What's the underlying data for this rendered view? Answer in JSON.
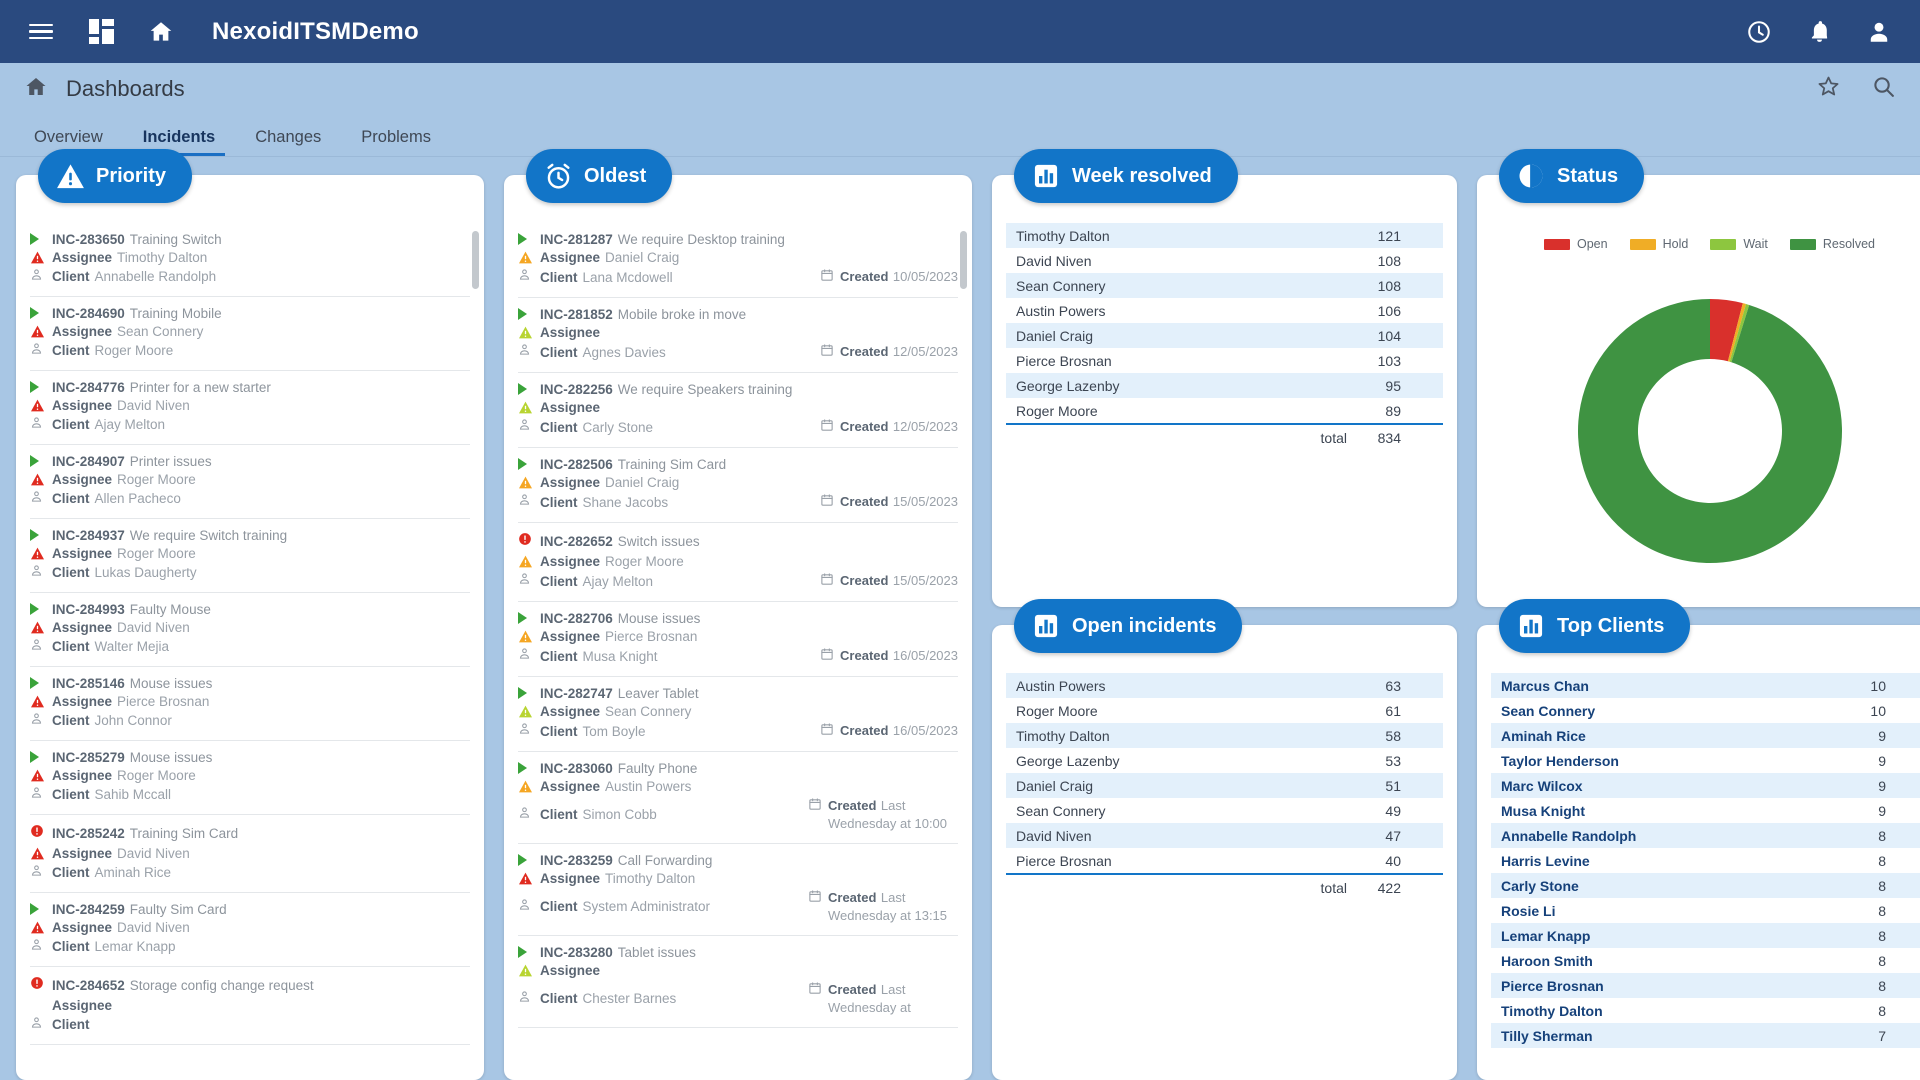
{
  "appbar": {
    "menu_icon": "hamburger-icon",
    "apps_icon": "grid-icon",
    "home_icon": "home-icon",
    "title": "NexoidITSMDemo",
    "history_icon": "clock-icon",
    "notifications_icon": "bell-icon",
    "account_icon": "user-icon"
  },
  "subheader": {
    "home_icon": "home-icon",
    "title": "Dashboards",
    "favorite_icon": "star-icon",
    "search_icon": "search-icon"
  },
  "tabs": [
    {
      "label": "Overview",
      "active": false
    },
    {
      "label": "Incidents",
      "active": true
    },
    {
      "label": "Changes",
      "active": false
    },
    {
      "label": "Problems",
      "active": false
    }
  ],
  "labels": {
    "assignee": "Assignee",
    "client": "Client",
    "created": "Created",
    "total": "total"
  },
  "priority_panel": {
    "title": "Priority",
    "icon": "warning-triangle-icon",
    "items": [
      {
        "id": "INC-283650",
        "subject": "Training Switch",
        "assignee": "Timothy Dalton",
        "client": "Annabelle Randolph",
        "state_icon": "play-icon",
        "priority_icon": "red-triangle-icon"
      },
      {
        "id": "INC-284690",
        "subject": "Training Mobile",
        "assignee": "Sean Connery",
        "client": "Roger Moore",
        "state_icon": "play-icon",
        "priority_icon": "red-triangle-icon"
      },
      {
        "id": "INC-284776",
        "subject": "Printer for a new starter",
        "assignee": "David Niven",
        "client": "Ajay Melton",
        "state_icon": "play-icon",
        "priority_icon": "red-triangle-icon"
      },
      {
        "id": "INC-284907",
        "subject": "Printer issues",
        "assignee": "Roger Moore",
        "client": "Allen Pacheco",
        "state_icon": "play-icon",
        "priority_icon": "red-triangle-icon"
      },
      {
        "id": "INC-284937",
        "subject": "We require Switch training",
        "assignee": "Roger Moore",
        "client": "Lukas Daugherty",
        "state_icon": "play-icon",
        "priority_icon": "red-triangle-icon"
      },
      {
        "id": "INC-284993",
        "subject": "Faulty Mouse",
        "assignee": "David Niven",
        "client": "Walter Mejia",
        "state_icon": "play-icon",
        "priority_icon": "red-triangle-icon"
      },
      {
        "id": "INC-285146",
        "subject": "Mouse issues",
        "assignee": "Pierce  Brosnan",
        "client": "John Connor",
        "state_icon": "play-icon",
        "priority_icon": "red-triangle-icon"
      },
      {
        "id": "INC-285279",
        "subject": "Mouse issues",
        "assignee": "Roger Moore",
        "client": "Sahib Mccall",
        "state_icon": "play-icon",
        "priority_icon": "red-triangle-icon"
      },
      {
        "id": "INC-285242",
        "subject": "Training Sim Card",
        "assignee": "David Niven",
        "client": "Aminah Rice",
        "state_icon": "red-circle-icon",
        "priority_icon": "red-triangle-icon"
      },
      {
        "id": "INC-284259",
        "subject": "Faulty Sim Card",
        "assignee": "David Niven",
        "client": "Lemar Knapp",
        "state_icon": "play-icon",
        "priority_icon": "red-triangle-icon"
      },
      {
        "id": "INC-284652",
        "subject": "Storage config change request",
        "assignee": "",
        "client": "",
        "state_icon": "red-circle-icon",
        "priority_icon": ""
      }
    ]
  },
  "oldest_panel": {
    "title": "Oldest",
    "icon": "alarm-clock-icon",
    "items": [
      {
        "id": "INC-281287",
        "subject": "We require Desktop training",
        "assignee": "Daniel Craig",
        "client": "Lana Mcdowell",
        "created": "10/05/2023",
        "state_icon": "play-icon",
        "priority_icon": "orange-triangle-icon"
      },
      {
        "id": "INC-281852",
        "subject": "Mobile broke in move",
        "assignee": "",
        "client": "Agnes Davies",
        "created": "12/05/2023",
        "state_icon": "play-icon",
        "priority_icon": "yellow-triangle-icon"
      },
      {
        "id": "INC-282256",
        "subject": "We require Speakers training",
        "assignee": "",
        "client": "Carly Stone",
        "created": "12/05/2023",
        "state_icon": "play-icon",
        "priority_icon": "yellow-triangle-icon"
      },
      {
        "id": "INC-282506",
        "subject": "Training Sim Card",
        "assignee": "Daniel Craig",
        "client": "Shane Jacobs",
        "created": "15/05/2023",
        "state_icon": "play-icon",
        "priority_icon": "orange-triangle-icon"
      },
      {
        "id": "INC-282652",
        "subject": "Switch issues",
        "assignee": "Roger Moore",
        "client": "Ajay Melton",
        "created": "15/05/2023",
        "state_icon": "red-circle-icon",
        "priority_icon": "orange-triangle-icon"
      },
      {
        "id": "INC-282706",
        "subject": "Mouse issues",
        "assignee": "Pierce  Brosnan",
        "client": "Musa Knight",
        "created": "16/05/2023",
        "state_icon": "play-icon",
        "priority_icon": "orange-triangle-icon"
      },
      {
        "id": "INC-282747",
        "subject": "Leaver Tablet",
        "assignee": "Sean Connery",
        "client": "Tom Boyle",
        "created": "16/05/2023",
        "state_icon": "play-icon",
        "priority_icon": "yellow-triangle-icon"
      },
      {
        "id": "INC-283060",
        "subject": "Faulty Phone",
        "assignee": "Austin Powers",
        "client": "Simon Cobb",
        "created": "Last Wednesday at 10:00",
        "state_icon": "play-icon",
        "priority_icon": "orange-triangle-icon"
      },
      {
        "id": "INC-283259",
        "subject": "Call Forwarding",
        "assignee": "Timothy Dalton",
        "client": "System Administrator",
        "created": "Last Wednesday at 13:15",
        "state_icon": "play-icon",
        "priority_icon": "red-triangle-icon"
      },
      {
        "id": "INC-283280",
        "subject": "Tablet issues",
        "assignee": "",
        "client": "Chester Barnes",
        "created": "Last Wednesday at",
        "state_icon": "play-icon",
        "priority_icon": "yellow-triangle-icon"
      }
    ]
  },
  "week_resolved_panel": {
    "title": "Week resolved",
    "icon": "bar-chart-icon",
    "rows": [
      {
        "name": "Timothy Dalton",
        "value": "121"
      },
      {
        "name": "David Niven",
        "value": "108"
      },
      {
        "name": "Sean Connery",
        "value": "108"
      },
      {
        "name": "Austin Powers",
        "value": "106"
      },
      {
        "name": "Daniel Craig",
        "value": "104"
      },
      {
        "name": "Pierce Brosnan",
        "value": "103"
      },
      {
        "name": "George Lazenby",
        "value": "95"
      },
      {
        "name": "Roger Moore",
        "value": "89"
      }
    ],
    "total_label": "total",
    "total_value": "834"
  },
  "open_incidents_panel": {
    "title": "Open incidents",
    "icon": "bar-chart-icon",
    "rows": [
      {
        "name": "Austin Powers",
        "value": "63"
      },
      {
        "name": "Roger Moore",
        "value": "61"
      },
      {
        "name": "Timothy Dalton",
        "value": "58"
      },
      {
        "name": "George Lazenby",
        "value": "53"
      },
      {
        "name": "Daniel Craig",
        "value": "51"
      },
      {
        "name": "Sean Connery",
        "value": "49"
      },
      {
        "name": "David Niven",
        "value": "47"
      },
      {
        "name": "Pierce Brosnan",
        "value": "40"
      }
    ],
    "total_label": "total",
    "total_value": "422"
  },
  "top_clients_panel": {
    "title": "Top Clients",
    "icon": "bar-chart-icon",
    "rows": [
      {
        "name": "Marcus Chan",
        "value": "10"
      },
      {
        "name": "Sean Connery",
        "value": "10"
      },
      {
        "name": "Aminah Rice",
        "value": "9"
      },
      {
        "name": "Taylor Henderson",
        "value": "9"
      },
      {
        "name": "Marc Wilcox",
        "value": "9"
      },
      {
        "name": "Musa Knight",
        "value": "9"
      },
      {
        "name": "Annabelle Randolph",
        "value": "8"
      },
      {
        "name": "Harris Levine",
        "value": "8"
      },
      {
        "name": "Carly Stone",
        "value": "8"
      },
      {
        "name": "Rosie Li",
        "value": "8"
      },
      {
        "name": "Lemar Knapp",
        "value": "8"
      },
      {
        "name": "Haroon Smith",
        "value": "8"
      },
      {
        "name": "Pierce Brosnan",
        "value": "8"
      },
      {
        "name": "Timothy Dalton",
        "value": "8"
      },
      {
        "name": "Tilly Sherman",
        "value": "7"
      }
    ]
  },
  "status_panel": {
    "title": "Status",
    "icon": "pie-chart-icon"
  },
  "chart_data": {
    "type": "pie",
    "title": "Status",
    "legend_position": "top",
    "labels": [
      "Open",
      "Hold",
      "Wait",
      "Resolved"
    ],
    "values": [
      4,
      0.4,
      0.4,
      95.2
    ],
    "colors": [
      "#d9302c",
      "#f0ad26",
      "#8dc63f",
      "#3f9342"
    ],
    "donut": true
  },
  "colors": {
    "brand_blue": "#1275c8",
    "appbar_blue": "#2a4a7f",
    "page_bg": "#a8c6e4",
    "row_stripe": "#e3f0fb",
    "link": "#16417a"
  }
}
